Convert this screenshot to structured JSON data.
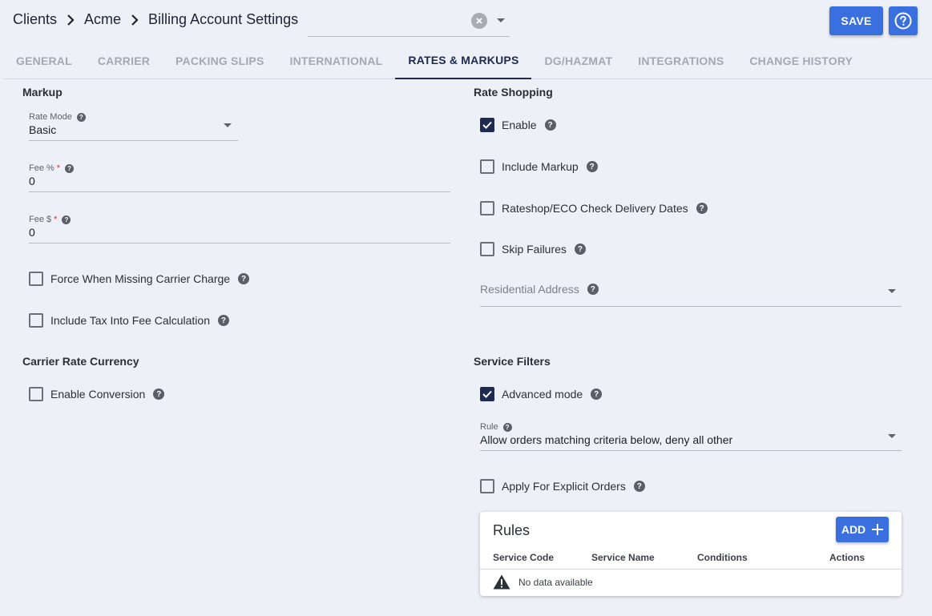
{
  "breadcrumb": {
    "items": [
      "Clients",
      "Acme",
      "Billing Account Settings"
    ]
  },
  "header": {
    "save_label": "SAVE"
  },
  "tabs": [
    {
      "label": "GENERAL",
      "active": false
    },
    {
      "label": "CARRIER",
      "active": false
    },
    {
      "label": "PACKING SLIPS",
      "active": false
    },
    {
      "label": "INTERNATIONAL",
      "active": false
    },
    {
      "label": "RATES & MARKUPS",
      "active": true
    },
    {
      "label": "DG/HAZMAT",
      "active": false
    },
    {
      "label": "INTEGRATIONS",
      "active": false
    },
    {
      "label": "CHANGE HISTORY",
      "active": false
    }
  ],
  "markup": {
    "title": "Markup",
    "rate_mode": {
      "label": "Rate Mode",
      "value": "Basic"
    },
    "fee_pct": {
      "label": "Fee %",
      "required": "*",
      "value": "0"
    },
    "fee_usd": {
      "label": "Fee $",
      "required": "*",
      "value": "0"
    },
    "force_missing": {
      "label": "Force When Missing Carrier Charge",
      "checked": false
    },
    "include_tax": {
      "label": "Include Tax Into Fee Calculation",
      "checked": false
    }
  },
  "carrier_rate_currency": {
    "title": "Carrier Rate Currency",
    "enable_conversion": {
      "label": "Enable Conversion",
      "checked": false
    }
  },
  "rate_shopping": {
    "title": "Rate Shopping",
    "enable": {
      "label": "Enable",
      "checked": true
    },
    "include_markup": {
      "label": "Include Markup",
      "checked": false
    },
    "rateshop_eco": {
      "label": "Rateshop/ECO Check Delivery Dates",
      "checked": false
    },
    "skip_failures": {
      "label": "Skip Failures",
      "checked": false
    },
    "residential_address": {
      "placeholder": "Residential Address"
    }
  },
  "service_filters": {
    "title": "Service Filters",
    "advanced_mode": {
      "label": "Advanced mode",
      "checked": true
    },
    "rule": {
      "label": "Rule",
      "value": "Allow orders matching criteria below, deny all other"
    },
    "apply_explicit": {
      "label": "Apply For Explicit Orders",
      "checked": false
    }
  },
  "rules_table": {
    "title": "Rules",
    "add_label": "ADD",
    "columns": [
      "Service Code",
      "Service Name",
      "Conditions",
      "Actions"
    ],
    "empty_text": "No data available"
  },
  "colors": {
    "primary": "#3a6fe0",
    "checked": "#1d2a52",
    "background": "#edf0f7"
  },
  "icons": [
    "chevron-right-icon",
    "clear-icon",
    "caret-down-icon",
    "help-circle-icon",
    "question-icon",
    "check-icon",
    "plus-icon",
    "warning-icon"
  ]
}
